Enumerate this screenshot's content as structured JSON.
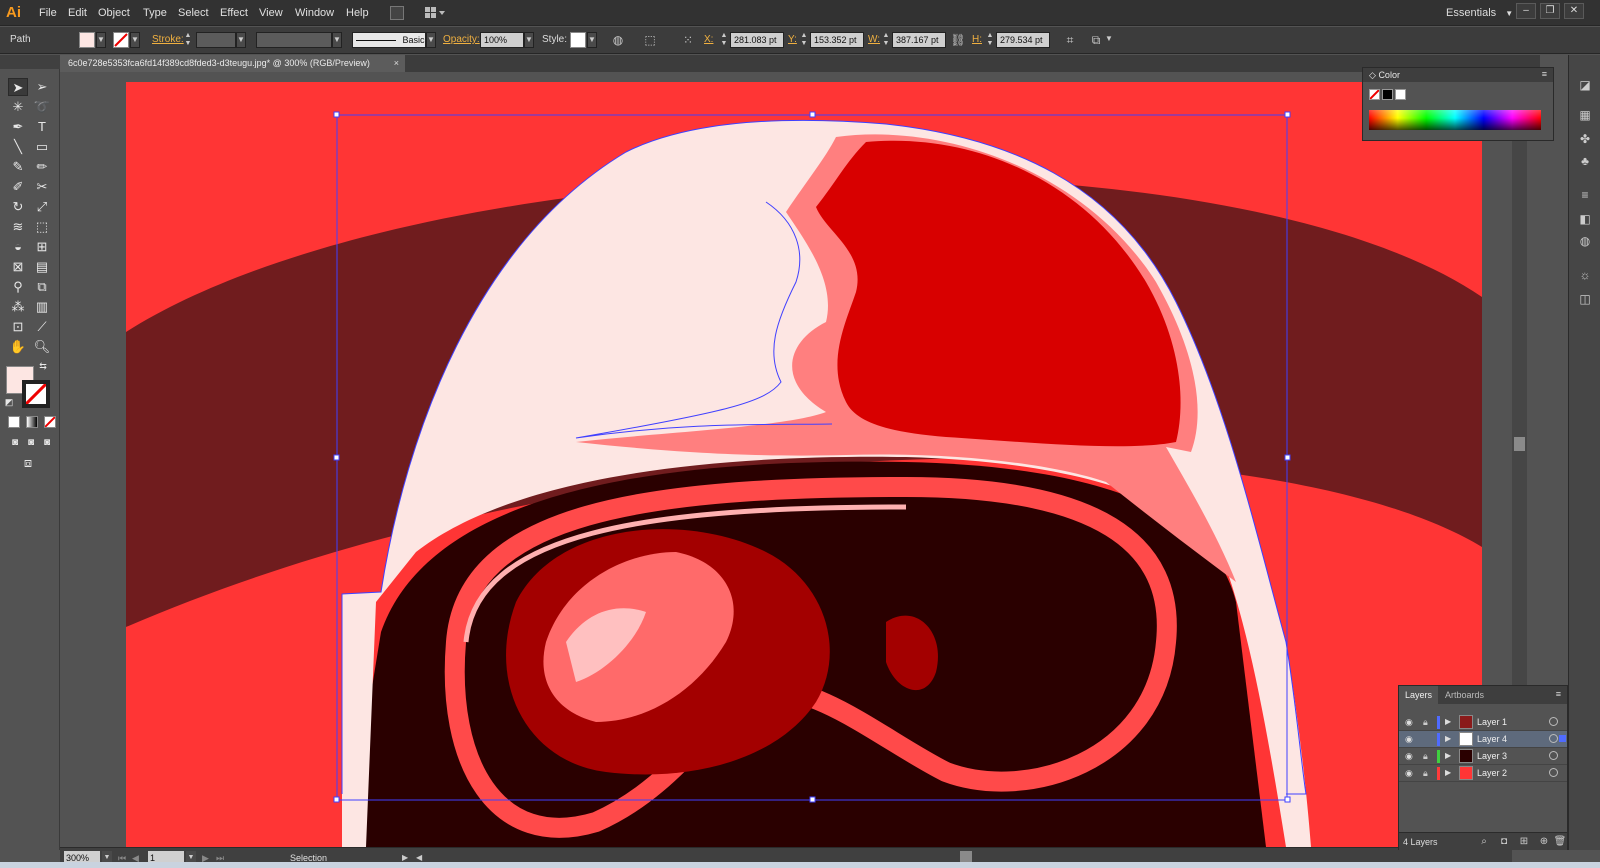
{
  "app": {
    "logo": "Ai"
  },
  "menu": [
    "File",
    "Edit",
    "Object",
    "Type",
    "Select",
    "Effect",
    "View",
    "Window",
    "Help"
  ],
  "workspace": {
    "label": "Essentials"
  },
  "window_controls": {
    "minimize": "–",
    "restore": "❐",
    "close": "✕"
  },
  "control_bar": {
    "object_type": "Path",
    "stroke_label": "Stroke:",
    "stroke_value": "",
    "brush_value": "",
    "stroke_profile": "Basic",
    "opacity_label": "Opacity:",
    "opacity_value": "100%",
    "style_label": "Style:",
    "x_label": "X:",
    "x_value": "281.083 pt",
    "y_label": "Y:",
    "y_value": "153.352 pt",
    "w_label": "W:",
    "w_value": "387.167 pt",
    "h_label": "H:",
    "h_value": "279.534 pt",
    "fill_color": "#fde6e3"
  },
  "document": {
    "tab_title": "6c0e728e5353fca6fd14f389cd8fded3-d3teugu.jpg* @ 300% (RGB/Preview)",
    "close": "×"
  },
  "status_bar": {
    "zoom": "300%",
    "artboard": "1",
    "tool": "Selection"
  },
  "tools": {
    "fill_color": "#fde6e3",
    "stroke": "none"
  },
  "color_panel": {
    "title": "Color",
    "collapse": "◇"
  },
  "layers_panel": {
    "tabs": [
      "Layers",
      "Artboards"
    ],
    "layers": [
      {
        "name": "Layer 1",
        "color": "#4f6bff",
        "thumb": "#8a1a1a",
        "locked": true,
        "selected": false
      },
      {
        "name": "Layer 4",
        "color": "#4f6bff",
        "thumb": "#ffffff",
        "locked": false,
        "selected": true
      },
      {
        "name": "Layer 3",
        "color": "#3fd13f",
        "thumb": "#2a0000",
        "locked": true,
        "selected": false
      },
      {
        "name": "Layer 2",
        "color": "#ff3b3b",
        "thumb": "#ff3535",
        "locked": true,
        "selected": false
      }
    ],
    "count": "4 Layers"
  },
  "artwork_colors": {
    "background": "#ff3535",
    "dark_band": "#701c1e",
    "helmet_white": "#fde6e3",
    "helmet_red": "#d80000",
    "helmet_pink": "#ff7f7f",
    "visor_dark": "#2a0000",
    "goggle_red": "#ff4a4a",
    "selection": "#4040ff"
  }
}
